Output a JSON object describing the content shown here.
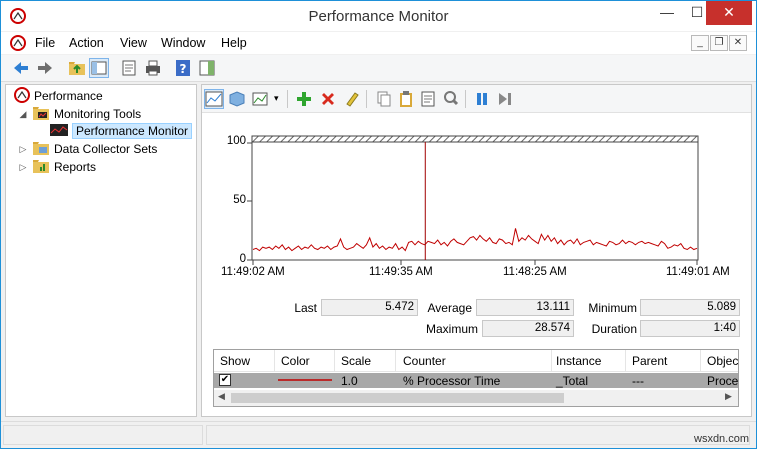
{
  "window": {
    "title": "Performance Monitor"
  },
  "menu": {
    "file": "File",
    "action": "Action",
    "view": "View",
    "window": "Window",
    "help": "Help"
  },
  "tree": {
    "root": "Performance",
    "monitoring_tools": "Monitoring Tools",
    "performance_monitor": "Performance Monitor",
    "data_collector_sets": "Data Collector Sets",
    "reports": "Reports"
  },
  "graph": {
    "y_ticks": [
      "100",
      "50",
      "0"
    ],
    "x_ticks": [
      "11:49:02 AM",
      "11:49:35 AM",
      "11:48:25 AM",
      "11:49:01 AM"
    ],
    "line_color": "#c00000",
    "marker_color": "#a00000"
  },
  "chart_data": {
    "type": "line",
    "ylim": [
      0,
      100
    ],
    "series": [
      {
        "values": [
          9,
          10,
          8,
          11,
          10,
          11,
          9,
          12,
          10,
          13,
          9,
          11,
          8,
          10,
          12,
          9,
          11,
          10,
          13,
          10,
          9,
          11,
          10,
          12,
          9,
          11,
          12,
          18,
          11,
          9,
          10,
          11,
          14,
          12,
          10,
          13,
          19,
          11,
          14,
          10,
          12,
          9,
          11,
          10,
          14,
          9,
          11,
          8,
          15,
          16,
          13,
          16,
          14,
          13,
          16,
          15,
          14,
          17,
          13,
          15,
          12,
          16,
          18,
          15,
          14,
          13,
          16,
          19,
          20,
          17,
          21,
          18,
          16,
          19,
          15,
          14,
          18,
          17,
          14,
          15,
          13,
          27,
          16,
          19,
          17,
          21,
          18,
          16,
          14,
          22,
          17,
          21,
          16,
          19,
          14,
          17,
          13,
          16,
          17,
          14,
          18,
          13,
          15,
          16,
          17,
          13,
          15,
          14,
          13,
          12,
          16,
          15,
          13,
          14,
          17,
          14,
          16,
          15,
          13,
          15,
          16,
          14,
          15,
          14,
          13,
          12,
          16,
          14,
          10,
          11,
          13,
          12,
          14,
          10,
          9,
          11,
          9,
          10
        ]
      }
    ],
    "marker_fraction": 0.388
  },
  "stats": {
    "last_label": "Last",
    "last_value": "5.472",
    "average_label": "Average",
    "average_value": "13.111",
    "minimum_label": "Minimum",
    "minimum_value": "5.089",
    "maximum_label": "Maximum",
    "maximum_value": "28.574",
    "duration_label": "Duration",
    "duration_value": "1:40"
  },
  "counters": {
    "headers": {
      "show": "Show",
      "color": "Color",
      "scale": "Scale",
      "counter": "Counter",
      "instance": "Instance",
      "parent": "Parent",
      "object": "Objec"
    },
    "row": {
      "checked": "✔",
      "scale": "1.0",
      "counter": "% Processor Time",
      "instance": "_Total",
      "parent": "---",
      "object": "Proce"
    }
  },
  "watermark": "wsxdn.com"
}
